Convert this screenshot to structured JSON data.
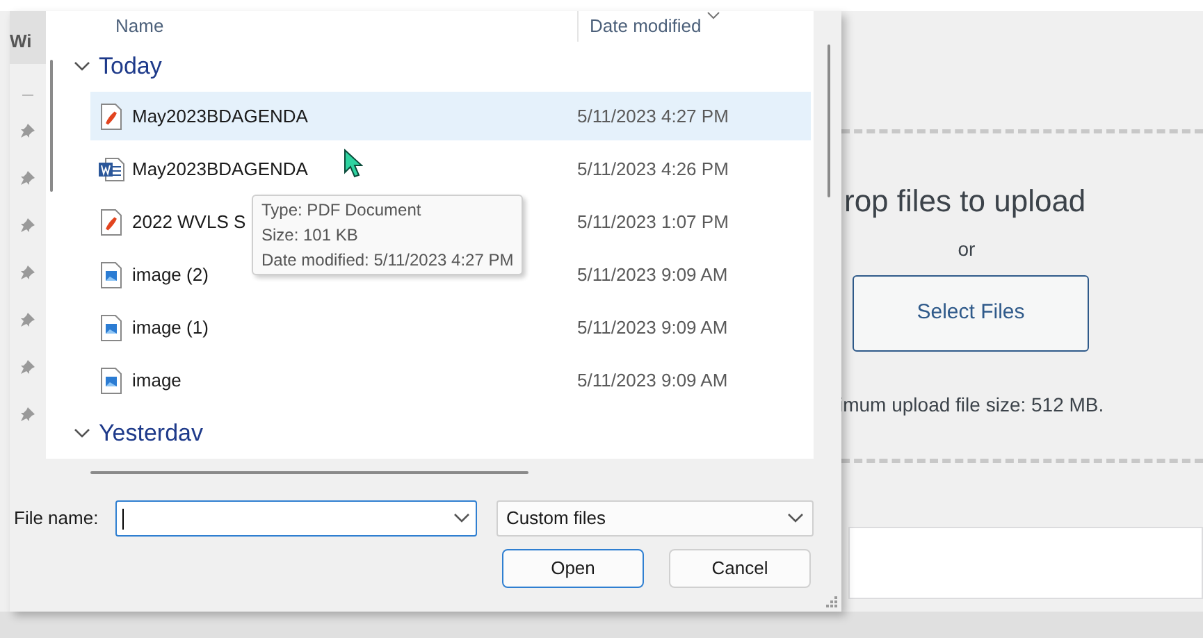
{
  "background_page": {
    "drop_heading": "rop files to upload",
    "or_text": "or",
    "select_button": "Select Files",
    "max_size_note": "imum upload file size: 512 MB."
  },
  "dialog": {
    "nav_pane": {
      "cut_label": "Wi"
    },
    "columns": [
      {
        "label": "Name",
        "sorted": false
      },
      {
        "label": "Date modified",
        "sorted": true
      }
    ],
    "groups": [
      {
        "label": "Today",
        "expanded": true,
        "files": [
          {
            "name": "May2023BDAGENDA",
            "kind": "pdf",
            "date": "5/11/2023 4:27 PM",
            "selected": true
          },
          {
            "name": "May2023BDAGENDA",
            "kind": "word",
            "date": "5/11/2023 4:26 PM",
            "selected": false
          },
          {
            "name": "2022 WVLS S",
            "kind": "pdf",
            "date": "5/11/2023 1:07 PM",
            "selected": false
          },
          {
            "name": "image (2)",
            "kind": "image",
            "date": "5/11/2023 9:09 AM",
            "selected": false
          },
          {
            "name": "image (1)",
            "kind": "image",
            "date": "5/11/2023 9:09 AM",
            "selected": false
          },
          {
            "name": "image",
            "kind": "image",
            "date": "5/11/2023 9:09 AM",
            "selected": false
          }
        ]
      },
      {
        "label": "Yesterdav",
        "expanded": true
      }
    ],
    "tooltip": {
      "lines": [
        "Type: PDF Document",
        "Size: 101 KB",
        "Date modified: 5/11/2023 4:27 PM"
      ]
    },
    "file_name_label": "File name:",
    "file_type": "Custom files",
    "buttons": [
      {
        "label": "Open",
        "default": true
      },
      {
        "label": "Cancel",
        "default": false
      }
    ]
  }
}
